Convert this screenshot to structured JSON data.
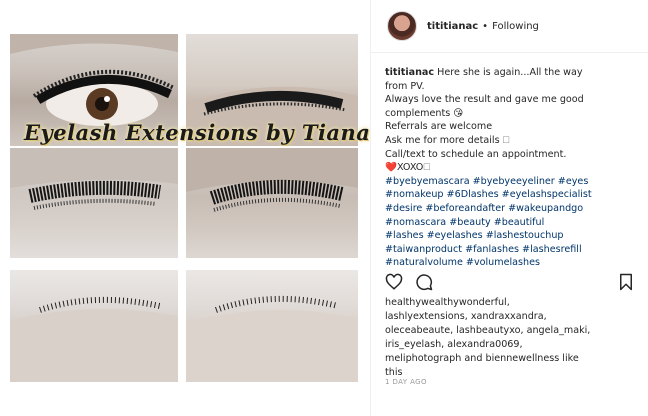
{
  "post": {
    "watermark_text": "Eyelash Extensions by Tiana",
    "username": "tititianac",
    "separator": "•",
    "follow_status": "Following",
    "caption": {
      "username": "tititianac",
      "lines": [
        "Here she is again...All the way",
        "from PV.",
        "Always love the result and gave me good",
        "complements 😘",
        "Referrals are welcome",
        "Ask me for more details 🗆",
        "Call/text to schedule an appointment.",
        "❤️XOXO🗆"
      ],
      "hashtag_lines": [
        "#byebyemascara #byebyeeyeliner #eyes",
        "#nomakeup #6Dlashes #eyelashspecialist",
        "#desire #beforeandafter #wakeupandgo",
        "#nomascara #beauty #beautiful",
        "#lashes #eyelashes #lashestouchup",
        "#taiwanproduct #fanlashes #lashesrefill",
        "#naturalvolume #volumelashes"
      ]
    },
    "icons": [
      "heart-icon",
      "comment-icon",
      "bookmark-icon"
    ],
    "liked_by_lines": [
      "healthywealthywonderful,",
      "lashlyextensions, xandraxxandra,",
      "oleceabeaute, lashbeautyxo, angela_maki,",
      "iris_eyelash, alexandra0069,",
      "meliphotograph and biennewellness like",
      "this"
    ],
    "timestamp": "1 DAY AGO"
  },
  "colors": {
    "text": "#262626",
    "hashtag": "#003569",
    "muted": "#999999",
    "divider": "#efefef"
  }
}
